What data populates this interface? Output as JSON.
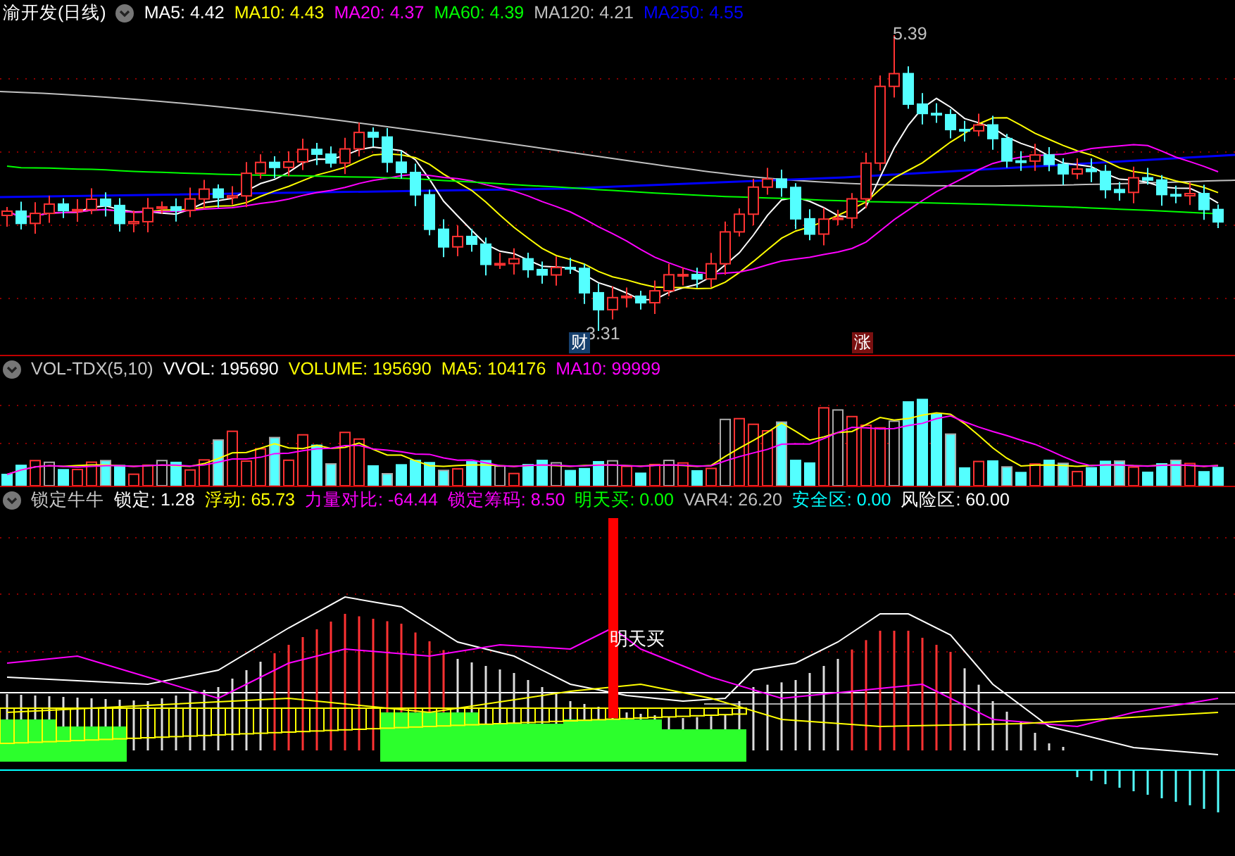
{
  "title": "渝开发(日线)",
  "price_pane": {
    "legend": [
      {
        "label": "MA5: 4.42",
        "color": "#ffffff"
      },
      {
        "label": "MA10: 4.43",
        "color": "#ffff00"
      },
      {
        "label": "MA20: 4.37",
        "color": "#ff00ff"
      },
      {
        "label": "MA60: 4.39",
        "color": "#00ff00"
      },
      {
        "label": "MA120: 4.21",
        "color": "#c0c0c0"
      },
      {
        "label": "MA250: 4.55",
        "color": "#0000ff"
      }
    ],
    "high_label": "5.39",
    "low_label": "3.31",
    "badges": [
      {
        "text": "财",
        "color": "#16406e"
      },
      {
        "text": "涨",
        "color": "#7a1010"
      }
    ]
  },
  "volume_pane": {
    "name": "VOL-TDX(5,10)",
    "legend": [
      {
        "label": "VVOL: 195690",
        "color": "#ffffff"
      },
      {
        "label": "VOLUME: 195690",
        "color": "#ffff00"
      },
      {
        "label": "MA5: 104176",
        "color": "#ffff00"
      },
      {
        "label": "MA10: 99999",
        "color": "#ff00ff"
      }
    ]
  },
  "indicator_pane": {
    "name": "锁定牛牛",
    "legend": [
      {
        "label": "锁定: 1.28",
        "color": "#ffffff"
      },
      {
        "label": "浮动: 65.73",
        "color": "#ffff00"
      },
      {
        "label": "力量对比: -64.44",
        "color": "#ff00ff"
      },
      {
        "label": "锁定筹码: 8.50",
        "color": "#ff00ff"
      },
      {
        "label": "明天买: 0.00",
        "color": "#00ff00"
      },
      {
        "label": "VAR4: 26.20",
        "color": "#c0c0c0"
      },
      {
        "label": "安全区: 0.00",
        "color": "#00ffff"
      },
      {
        "label": "风险区: 60.00",
        "color": "#ffffff"
      }
    ],
    "signal_label": "明天买"
  }
}
